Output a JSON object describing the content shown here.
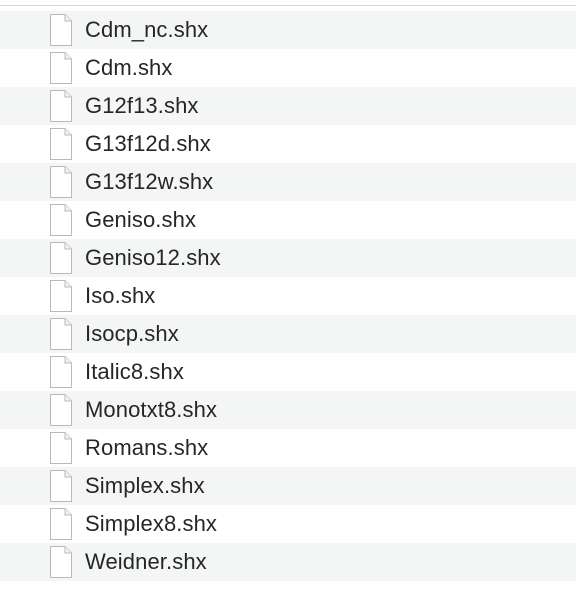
{
  "files": [
    {
      "name": "Cdm_nc.shx",
      "icon": "document-icon"
    },
    {
      "name": "Cdm.shx",
      "icon": "document-icon"
    },
    {
      "name": "G12f13.shx",
      "icon": "document-icon"
    },
    {
      "name": "G13f12d.shx",
      "icon": "document-icon"
    },
    {
      "name": "G13f12w.shx",
      "icon": "document-icon"
    },
    {
      "name": "Geniso.shx",
      "icon": "document-icon"
    },
    {
      "name": "Geniso12.shx",
      "icon": "document-icon"
    },
    {
      "name": "Iso.shx",
      "icon": "document-icon"
    },
    {
      "name": "Isocp.shx",
      "icon": "document-icon"
    },
    {
      "name": "Italic8.shx",
      "icon": "document-icon"
    },
    {
      "name": "Monotxt8.shx",
      "icon": "document-icon"
    },
    {
      "name": "Romans.shx",
      "icon": "document-icon"
    },
    {
      "name": "Simplex.shx",
      "icon": "document-icon"
    },
    {
      "name": "Simplex8.shx",
      "icon": "document-icon"
    },
    {
      "name": "Weidner.shx",
      "icon": "document-icon"
    }
  ],
  "colors": {
    "stripe": "#f4f5f5",
    "text": "#262626",
    "icon_outline": "#b9b9b9"
  }
}
